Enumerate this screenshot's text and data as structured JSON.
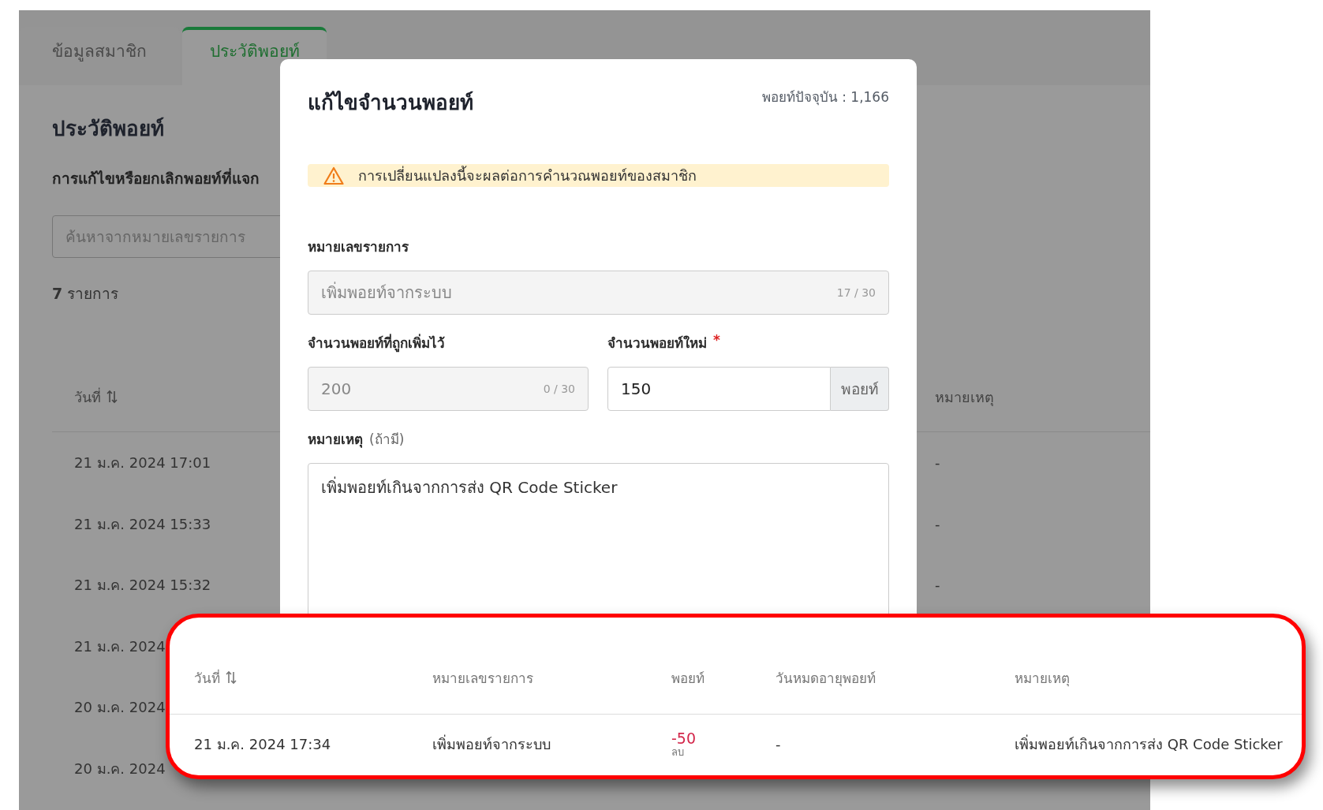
{
  "tabs": [
    {
      "label": "ข้อมูลสมาชิก",
      "selected": false
    },
    {
      "label": "ประวัติพอยท์",
      "selected": true
    }
  ],
  "page": {
    "heading": "ประวัติพอยท์",
    "description": "การแก้ไขหรือยกเลิกพอยท์ที่แจก",
    "search": {
      "placeholder": "ค้นหาจากหมายเลขรายการ"
    },
    "count": "**7** รายการ"
  },
  "history_table": {
    "columns": [
      {
        "label": "วันที่",
        "sortable": true
      },
      {
        "label": "หมายเหตุ",
        "sortable": false
      }
    ],
    "rows": [
      {
        "date": "21 ม.ค. 2024 17:01",
        "remark": "-"
      },
      {
        "date": "21 ม.ค. 2024 15:33",
        "remark": "-"
      },
      {
        "date": "21 ม.ค. 2024 15:32",
        "remark": "-"
      },
      {
        "date": "21 ม.ค. 2024"
      },
      {
        "date": "20 ม.ค. 2024"
      },
      {
        "date": "20 ม.ค. 2024"
      }
    ]
  },
  "modal": {
    "title": "แก้ไขจำนวนพอยท์",
    "current_points": "พอยท์ปัจจุบัน : 1,166",
    "alert": "การเปลี่ยนแปลงนี้จะผลต่อการคำนวณพอยท์ของสมาชิก",
    "transaction_field": {
      "label": "หมายเลขรายการ",
      "value": "เพิ่มพอยท์จากระบบ",
      "counter": "17 / 30",
      "disabled": true
    },
    "added_points_field": {
      "label": "จำนวนพอยท์ที่ถูกเพิ่มไว้",
      "value": "200",
      "counter": "0 / 30",
      "disabled": true
    },
    "new_points_field": {
      "label": "จำนวนพอยท์ใหม่",
      "required_mark": "*",
      "value": "150",
      "unit": "พอยท์",
      "disabled": false
    },
    "note_field": {
      "label": "หมายเหตุ",
      "hint": "(ถ้ามี)",
      "value": "เพิ่มพอยท์เกินจากการส่ง QR Code Sticker"
    }
  },
  "highlight_table": {
    "columns": [
      {
        "label": "วันที่",
        "sortable": true
      },
      {
        "label": "หมายเลขรายการ",
        "sortable": false
      },
      {
        "label": "พอยท์",
        "sortable": false
      },
      {
        "label": "วันหมดอายุพอยท์",
        "sortable": false
      },
      {
        "label": "หมายเหตุ",
        "sortable": false
      }
    ],
    "rows": [
      {
        "date": "21 ม.ค. 2024 17:34",
        "transaction": "เพิ่มพอยท์จากระบบ",
        "points": {
          "value": "-50",
          "kind": "deduct",
          "caption": "ลบ"
        },
        "expiry": "-",
        "remark": "เพิ่มพอยท์เกินจากการส่ง QR Code Sticker"
      }
    ]
  }
}
